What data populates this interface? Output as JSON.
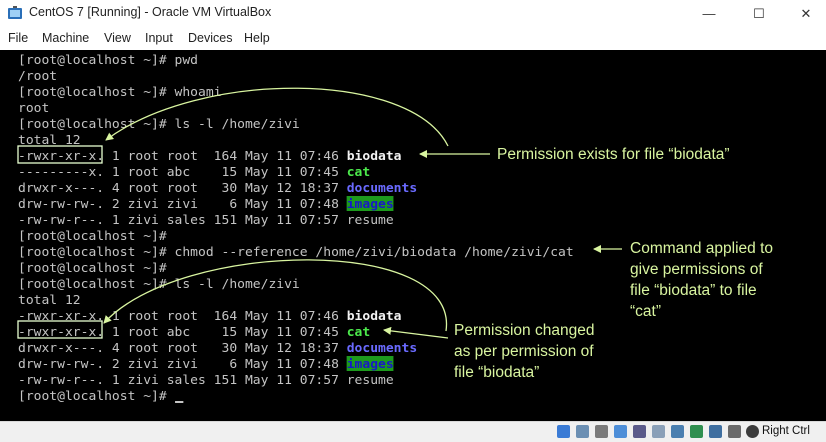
{
  "window": {
    "title": "CentOS 7 [Running] - Oracle VM VirtualBox",
    "minimize_glyph": "—",
    "maximize_glyph": "☐",
    "close_glyph": "✕"
  },
  "menu": [
    "File",
    "Machine",
    "View",
    "Input",
    "Devices",
    "Help"
  ],
  "terminal": {
    "lines": [
      {
        "text": "[root@localhost ~]# pwd"
      },
      {
        "text": "/root"
      },
      {
        "text": "[root@localhost ~]# whoami"
      },
      {
        "text": "root"
      },
      {
        "text": "[root@localhost ~]# ls -l /home/zivi"
      },
      {
        "text": "total 12"
      },
      {
        "text": "-rwxr-xr-x. 1 root root  164 May 11 07:46 ",
        "file": "biodata",
        "color": "white"
      },
      {
        "text": "---------x. 1 root abc    15 May 11 07:45 ",
        "file": "cat",
        "color": "green"
      },
      {
        "text": "drwxr-x---. 4 root root   30 May 12 18:37 ",
        "file": "documents",
        "color": "blue"
      },
      {
        "text": "drw-rw-rw-. 2 zivi zivi    6 May 11 07:48 ",
        "file": "images",
        "color": "hl"
      },
      {
        "text": "-rw-rw-r--. 1 zivi sales 151 May 11 07:57 resume"
      },
      {
        "text": "[root@localhost ~]#"
      },
      {
        "text": "[root@localhost ~]# chmod --reference /home/zivi/biodata /home/zivi/cat"
      },
      {
        "text": "[root@localhost ~]#"
      },
      {
        "text": "[root@localhost ~]# ls -l /home/zivi"
      },
      {
        "text": "total 12"
      },
      {
        "text": "-rwxr-xr-x. 1 root root  164 May 11 07:46 ",
        "file": "biodata",
        "color": "white"
      },
      {
        "text": "-rwxr-xr-x. 1 root abc    15 May 11 07:45 ",
        "file": "cat",
        "color": "green"
      },
      {
        "text": "drwxr-x---. 4 root root   30 May 12 18:37 ",
        "file": "documents",
        "color": "blue"
      },
      {
        "text": "drw-rw-rw-. 2 zivi zivi    6 May 11 07:48 ",
        "file": "images",
        "color": "hl"
      },
      {
        "text": "-rw-rw-r--. 1 zivi sales 151 May 11 07:57 resume"
      },
      {
        "text": "[root@localhost ~]# ",
        "cursor": true
      }
    ]
  },
  "annotations": {
    "perm_exists": "Permission exists for file “biodata”",
    "cmd_applied": [
      "Command applied to",
      "give permissions of",
      "file “biodata” to file",
      "“cat”"
    ],
    "perm_changed": [
      "Permission changed",
      "as per permission of",
      "file “biodata”"
    ],
    "color": "#d9f5a0"
  },
  "statusbar": {
    "host_key": "Right Ctrl"
  }
}
